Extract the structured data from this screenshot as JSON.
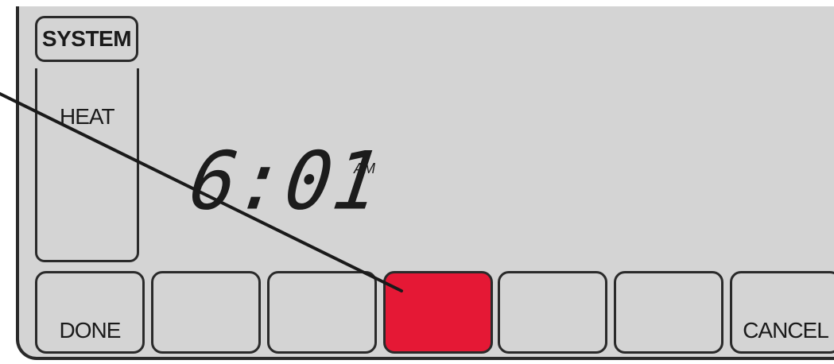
{
  "system_button": {
    "label": "SYSTEM"
  },
  "mode_panel": {
    "label": "HEAT"
  },
  "clock": {
    "time": "6:01",
    "ampm": "AM"
  },
  "softkeys": [
    {
      "label": "DONE",
      "active": false
    },
    {
      "label": "",
      "active": false
    },
    {
      "label": "",
      "active": false
    },
    {
      "label": "",
      "active": true
    },
    {
      "label": "",
      "active": false
    },
    {
      "label": "",
      "active": false
    },
    {
      "label": "CANCEL",
      "active": false
    }
  ],
  "colors": {
    "screen_bg": "#d4d4d4",
    "highlight": "#e51835",
    "outline": "#2a2a2a"
  }
}
